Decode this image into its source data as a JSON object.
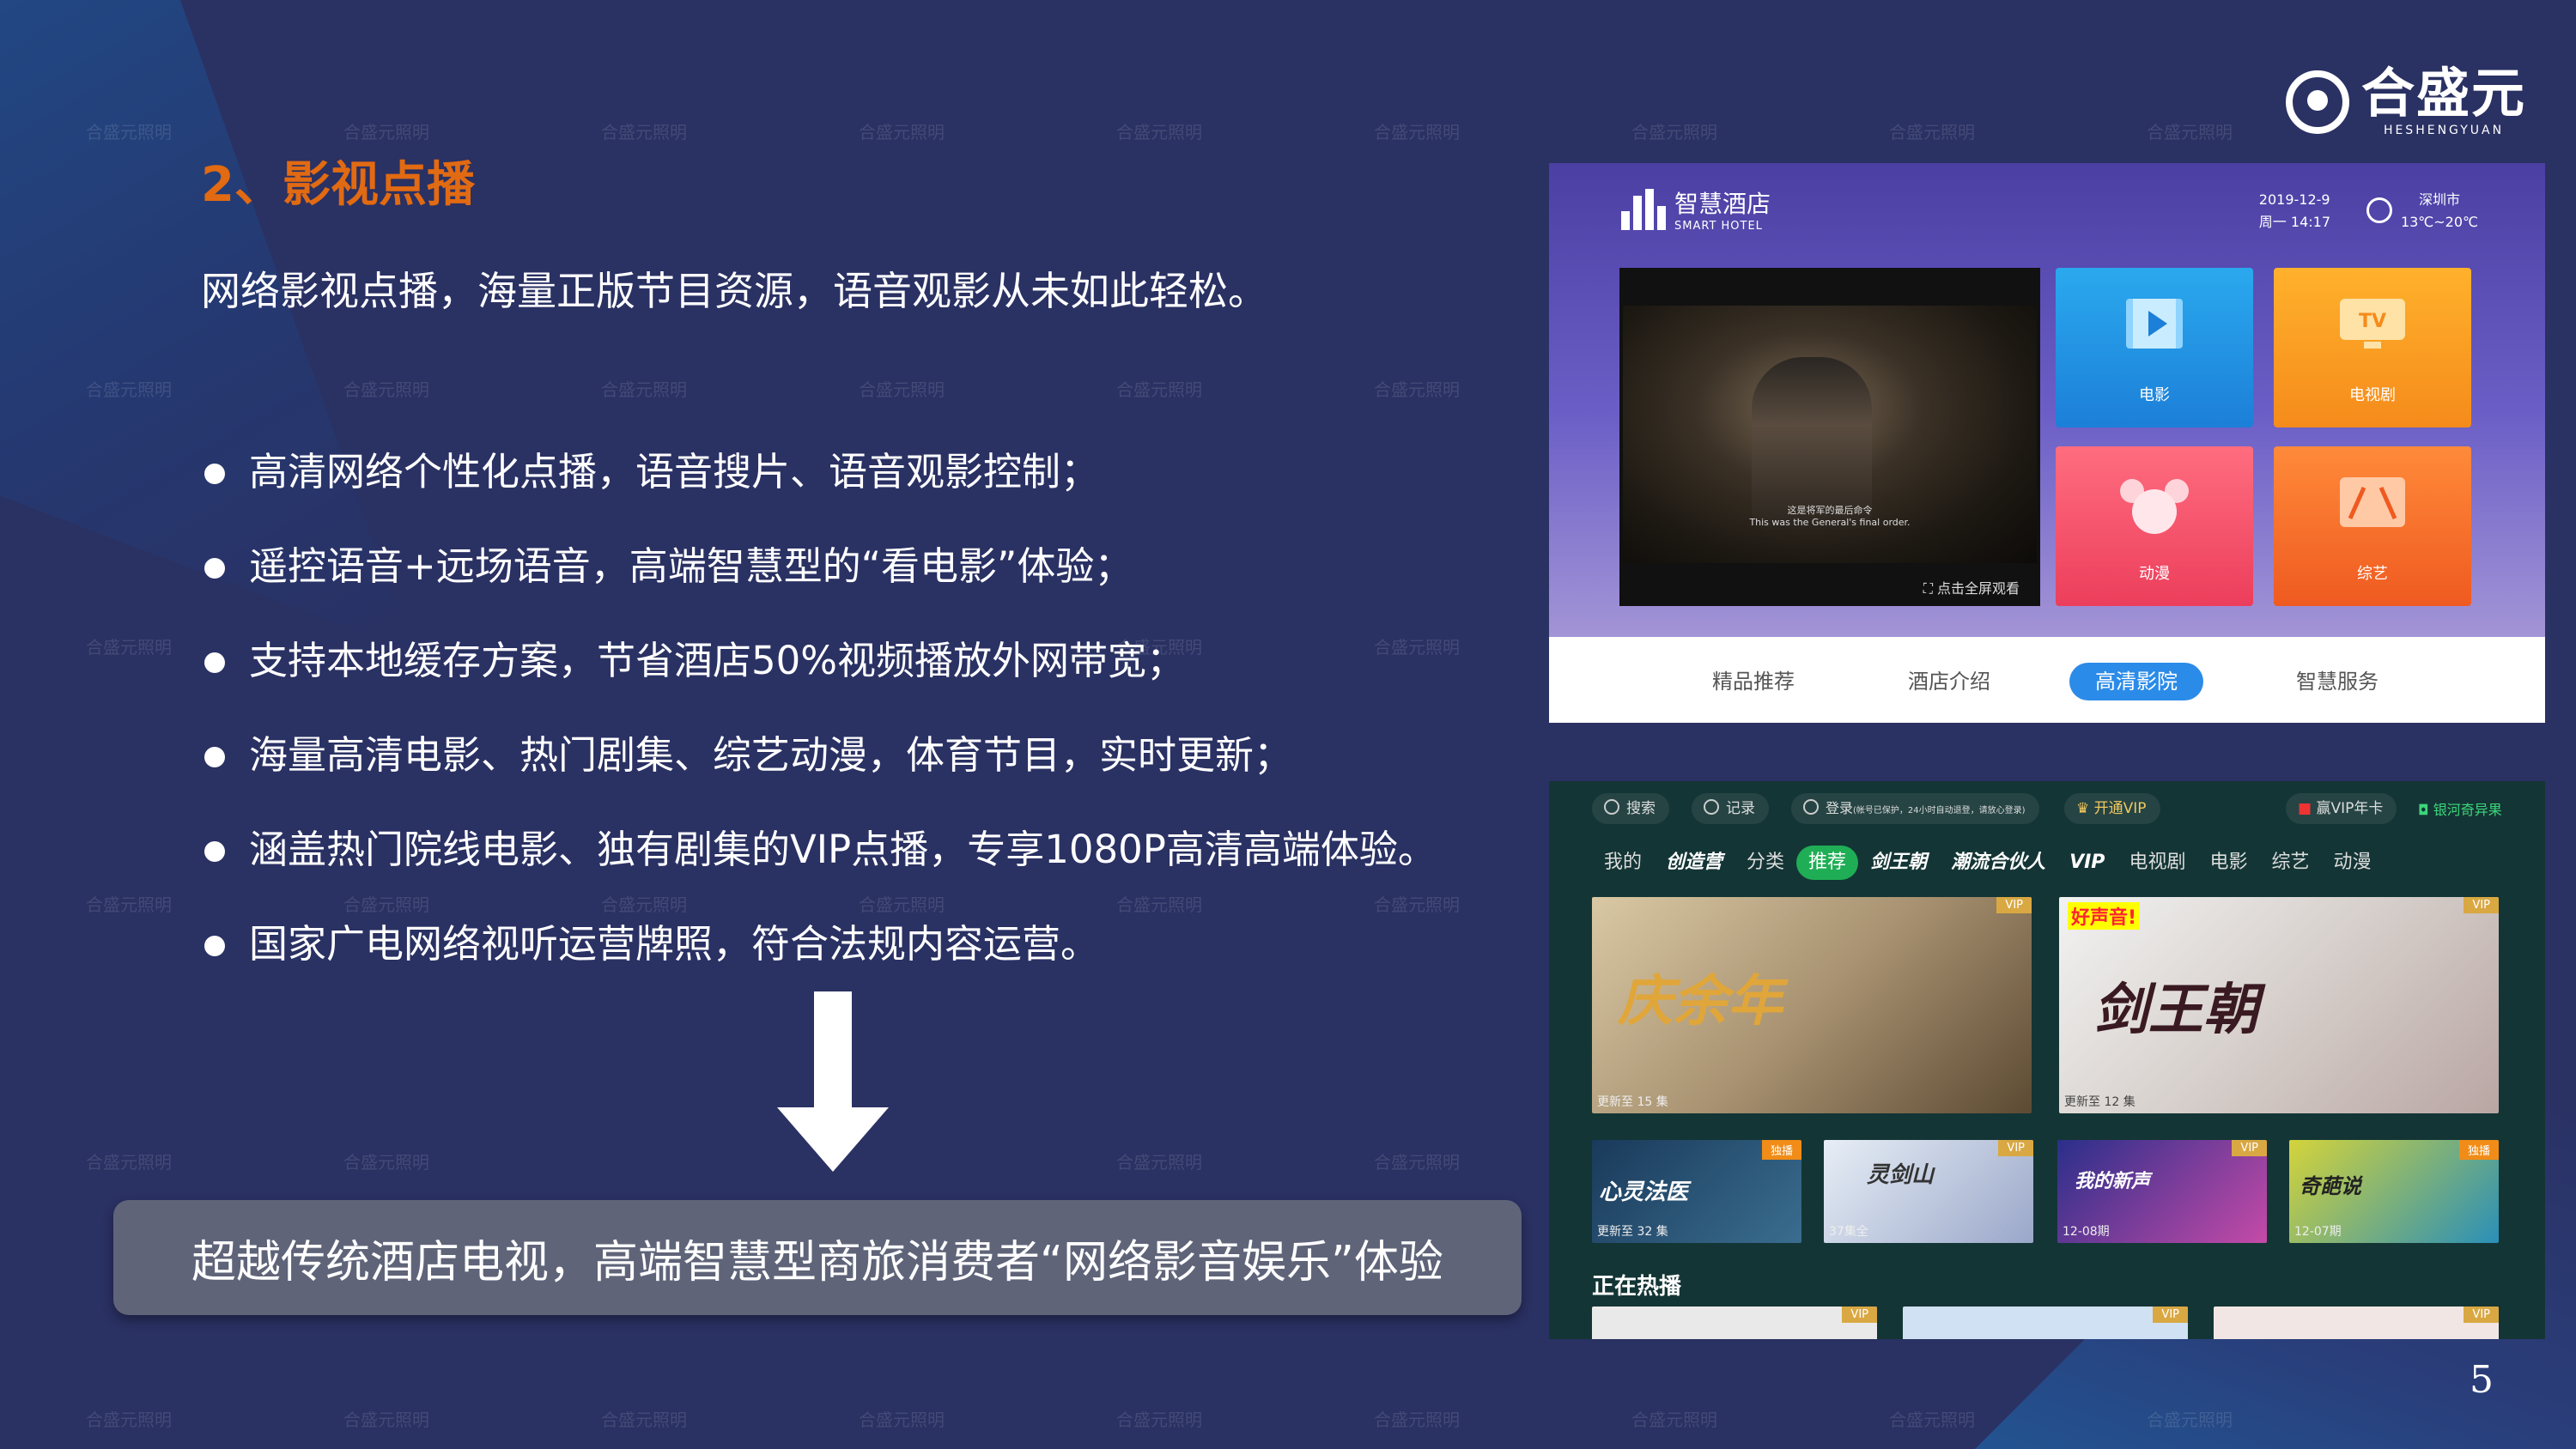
{
  "watermark_text": "合盛元照明",
  "logo": {
    "cn": "合盛元",
    "en": "HESHENGYUAN"
  },
  "slide": {
    "title": "2、影视点播",
    "intro": "网络影视点播，海量正版节目资源，语音观影从未如此轻松。",
    "bullets": [
      "高清网络个性化点播，语音搜片、语音观影控制；",
      "遥控语音+远场语音，高端智慧型的“看电影”体验；",
      "支持本地缓存方案，节省酒店50%视频播放外网带宽；",
      "海量高清电影、热门剧集、综艺动漫，体育节目，实时更新；",
      "涵盖热门院线电影、独有剧集的VIP点播，专享1080P高清高端体验。",
      "国家广电网络视听运营牌照，符合法规内容运营。"
    ],
    "callout": "超越传统酒店电视，高端智慧型商旅消费者“网络影音娱乐”体验",
    "page_number": "5"
  },
  "screen1": {
    "brand_cn": "智慧酒店",
    "brand_en": "SMART HOTEL",
    "date": "2019-12-9",
    "time": "周一 14:17",
    "city": "深圳市",
    "temp": "13℃~20℃",
    "video_subtitle_cn": "这是将军的最后命令",
    "video_subtitle_en": "This was the General's final order.",
    "fullscreen_hint": "⛶ 点击全屏观看",
    "tiles": {
      "movie": "电影",
      "tv": "电视剧",
      "tv_badge": "TV",
      "anime": "动漫",
      "variety": "综艺"
    },
    "nav": [
      "精品推荐",
      "酒店介绍",
      "高清影院",
      "智慧服务"
    ]
  },
  "screen2": {
    "top": {
      "search": "搜索",
      "history": "记录",
      "login": "登录",
      "login_note": "(帐号已保护，24小时自动退登，请放心登录)",
      "vip": "开通VIP",
      "vip_year": "赢VIP年卡",
      "brand": "银河奇异果"
    },
    "tabs": [
      "我的",
      "创造营",
      "分类",
      "推荐",
      "剑王朝",
      "潮流合伙人",
      "VIP",
      "电视剧",
      "电影",
      "综艺",
      "动漫"
    ],
    "posters": {
      "qyn": {
        "title": "庆余年",
        "caption": "更新至 15 集",
        "badge": "VIP"
      },
      "jwc": {
        "title": "剑王朝",
        "tag": "好声音!",
        "caption": "更新至 12 集",
        "badge": "VIP"
      },
      "s1": {
        "title": "心灵法医",
        "caption": "更新至 32 集",
        "badge": "独播"
      },
      "s2": {
        "title": "灵剑山",
        "caption": "37集全",
        "badge": "VIP"
      },
      "s3": {
        "title": "我的新声",
        "caption": "12-08期",
        "badge": "VIP"
      },
      "s4": {
        "title": "奇葩说",
        "caption": "12-07期",
        "badge": "独播"
      }
    },
    "section_title": "正在热播",
    "bottom_badges": [
      "VIP",
      "VIP",
      "VIP"
    ]
  }
}
